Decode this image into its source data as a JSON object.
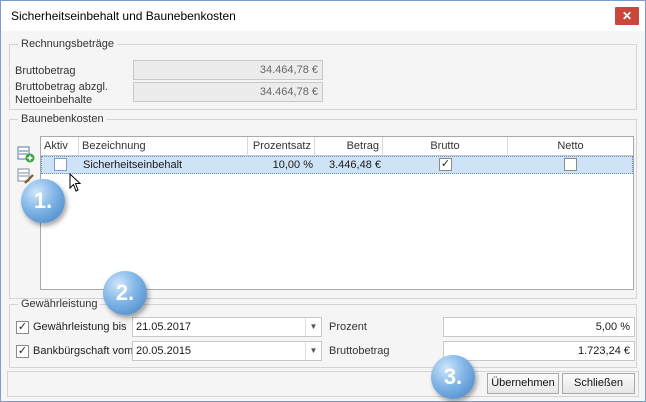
{
  "window": {
    "title": "Sicherheitseinbehalt und Baunebenkosten",
    "close_glyph": "✕"
  },
  "rechnungsbetraege": {
    "legend": "Rechnungsbeträge",
    "bruttobetrag_label": "Bruttobetrag",
    "bruttobetrag_value": "34.464,78 €",
    "abzgl_label_line1": "Bruttobetrag abzgl.",
    "abzgl_label_line2": "Nettoeinbehalte",
    "abzgl_value": "34.464,78 €"
  },
  "baunebenkosten": {
    "legend": "Baunebenkosten",
    "columns": [
      "Aktiv",
      "Bezeichnung",
      "Prozentsatz",
      "Betrag",
      "Brutto",
      "Netto"
    ],
    "rows": [
      {
        "aktiv": false,
        "bezeichnung": "Sicherheitseinbehalt",
        "prozentsatz": "10,00 %",
        "betrag": "3.446,48 €",
        "brutto": true,
        "netto": false
      }
    ],
    "add_icon": "add-row-icon",
    "edit_icon": "edit-row-icon"
  },
  "gewaehrleistung": {
    "legend": "Gewährleistung",
    "gewaehrleistung_bis_label": "Gewährleistung bis",
    "gewaehrleistung_bis_checked": true,
    "gewaehrleistung_bis_date": "21.05.2017",
    "bankbuergschaft_label": "Bankbürgschaft vom",
    "bankbuergschaft_checked": true,
    "bankbuergschaft_date": "20.05.2015",
    "prozent_label": "Prozent",
    "prozent_value": "5,00 %",
    "bruttobetrag_label": "Bruttobetrag",
    "bruttobetrag_value": "1.723,24 €"
  },
  "badges": {
    "one": "1.",
    "two": "2.",
    "three": "3."
  },
  "buttons": {
    "apply": "Übernehmen",
    "close": "Schließen"
  },
  "colors": {
    "selection": "#cfe3f7",
    "close_button": "#c9473b",
    "badge": "#5a9ad8"
  }
}
